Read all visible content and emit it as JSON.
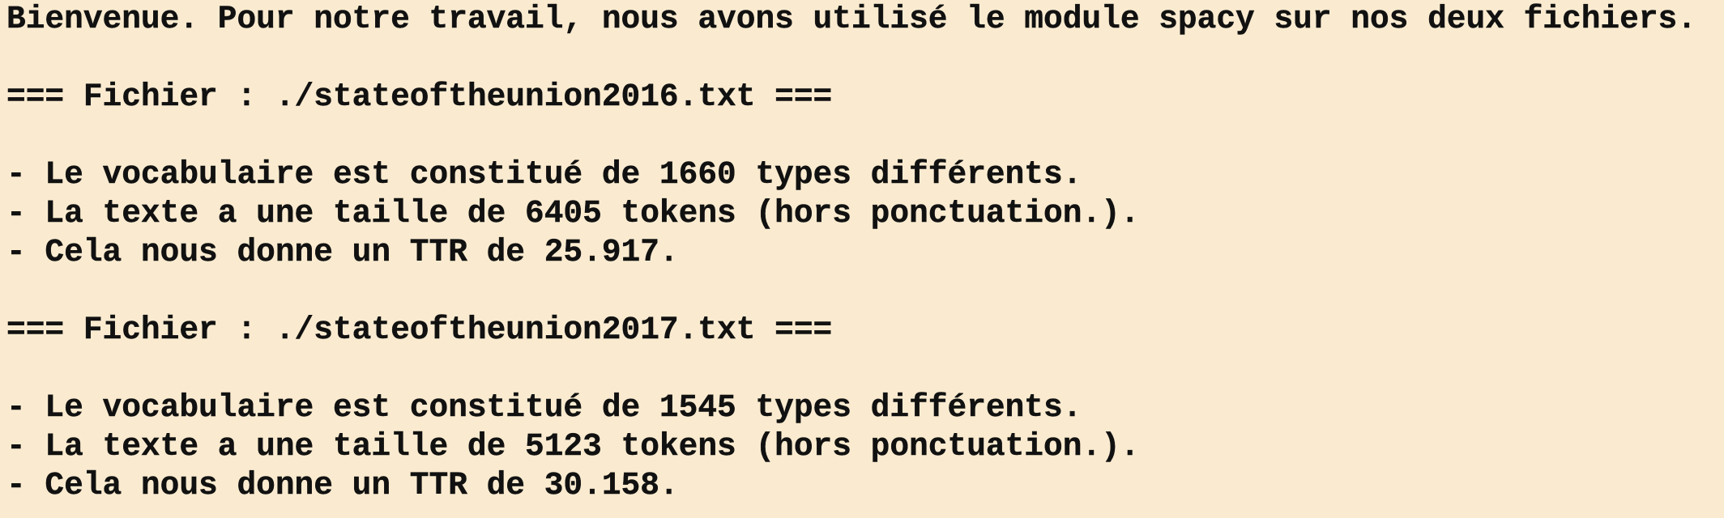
{
  "colors": {
    "background": "#faebd0",
    "text": "#111111"
  },
  "terminal": {
    "intro": "Bienvenue. Pour notre travail, nous avons utilisé le module spacy sur nos deux fichiers.",
    "files": [
      {
        "header": "=== Fichier : ./stateoftheunion2016.txt ===",
        "vocab": "- Le vocabulaire est constitué de 1660 types différents.",
        "size": "- La texte a une taille de 6405 tokens (hors ponctuation.).",
        "ttr": "- Cela nous donne un TTR de 25.917."
      },
      {
        "header": "=== Fichier : ./stateoftheunion2017.txt ===",
        "vocab": "- Le vocabulaire est constitué de 1545 types différents.",
        "size": "- La texte a une taille de 5123 tokens (hors ponctuation.).",
        "ttr": "- Cela nous donne un TTR de 30.158."
      }
    ]
  }
}
